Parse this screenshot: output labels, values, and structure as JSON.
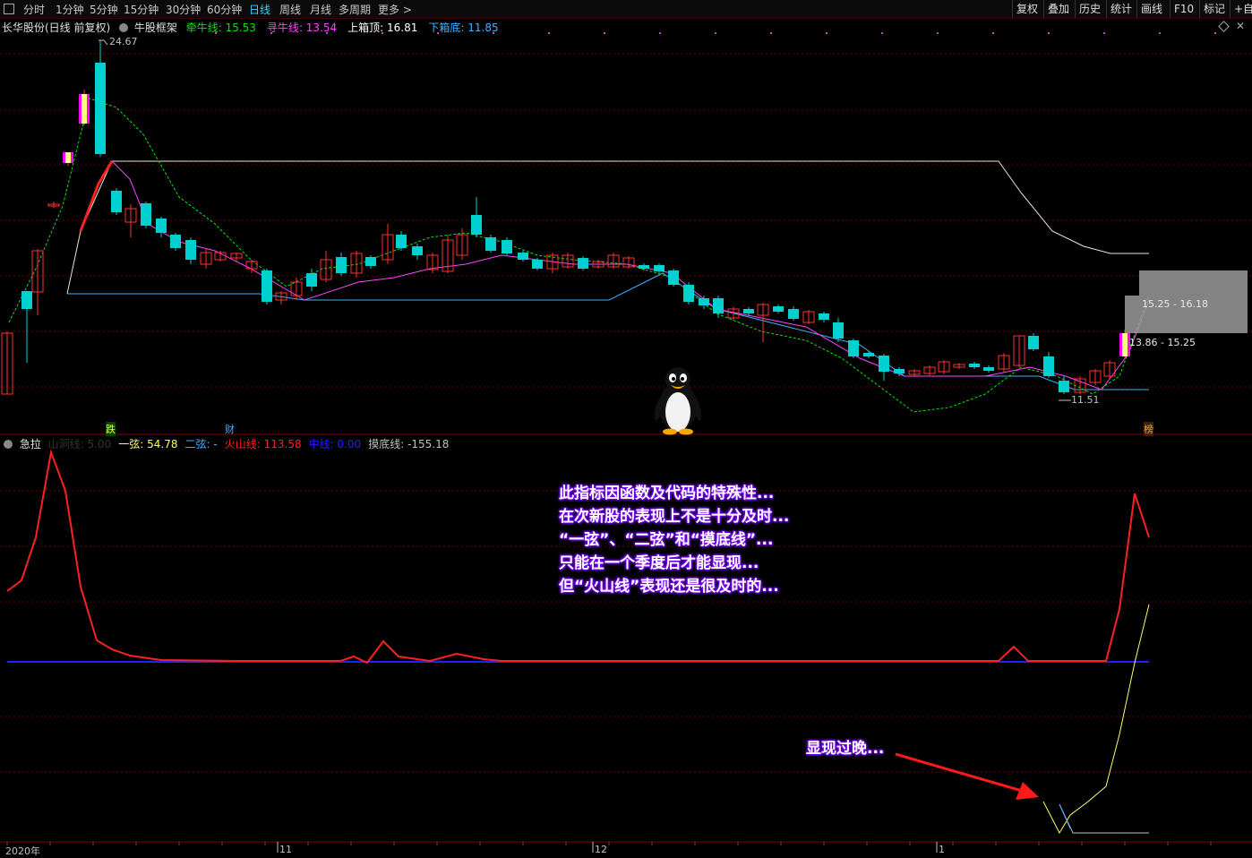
{
  "toolbar": {
    "periods": [
      "分时",
      "1分钟",
      "5分钟",
      "15分钟",
      "30分钟",
      "60分钟",
      "日线",
      "周线",
      "月线",
      "多周期",
      "更多 >"
    ],
    "active_period": "日线",
    "right_buttons": [
      "复权",
      "叠加",
      "历史",
      "统计",
      "画线",
      "F10",
      "标记",
      "+自选"
    ]
  },
  "main_panel": {
    "stock": "长华股份(日线 前复权)",
    "indicator_name": "牛股框架",
    "legend": [
      {
        "label": "牵牛线",
        "value": "15.53",
        "color": "#00e600"
      },
      {
        "label": "寻牛线",
        "value": "13.54",
        "color": "#ff44ff"
      },
      {
        "label": "上箱顶",
        "value": "16.81",
        "color": "#ffffff"
      },
      {
        "label": "下箱底",
        "value": "11.85",
        "color": "#40b0ff"
      }
    ],
    "high_label": "24.67",
    "low_label": "11.51",
    "range1": "15.25 - 16.18",
    "range2": "13.86 - 15.25",
    "marker_die": "跌",
    "marker_cai": "财",
    "marker_bang": "榜"
  },
  "sub_panel": {
    "name": "急拉",
    "legend": [
      {
        "label": "山洞线",
        "value": "5.00",
        "color": "#333333"
      },
      {
        "label": "一弦",
        "value": "54.78",
        "color": "#ffff66"
      },
      {
        "label": "二弦",
        "value": "-",
        "color": "#40b0ff"
      },
      {
        "label": "火山线",
        "value": "113.58",
        "color": "#ff2020"
      },
      {
        "label": "中线",
        "value": "0.00",
        "color": "#2020ff"
      },
      {
        "label": "摸底线",
        "value": "-155.18",
        "color": "#c0c0c0"
      }
    ]
  },
  "annotations": {
    "note_lines": [
      "此指标因函数及代码的特殊性...",
      "在次新股的表现上不是十分及时...",
      "“一弦”、“二弦”和“摸底线”...",
      "只能在一个季度后才能显现...",
      "但“火山线”表现还是很及时的..."
    ],
    "late_note": "显现过晚..."
  },
  "time_axis": {
    "labels": [
      "2020年",
      "11",
      "12",
      "1"
    ]
  },
  "colors": {
    "up": "#ff3030",
    "down": "#00d0d0",
    "grid": "#6a0000",
    "green_line": "#00e600",
    "magenta_line": "#ff44ff",
    "blue_line": "#40b0ff",
    "volcano_line": "#ff2020",
    "middle_line": "#2020ff",
    "string_line": "#ffff66"
  }
}
